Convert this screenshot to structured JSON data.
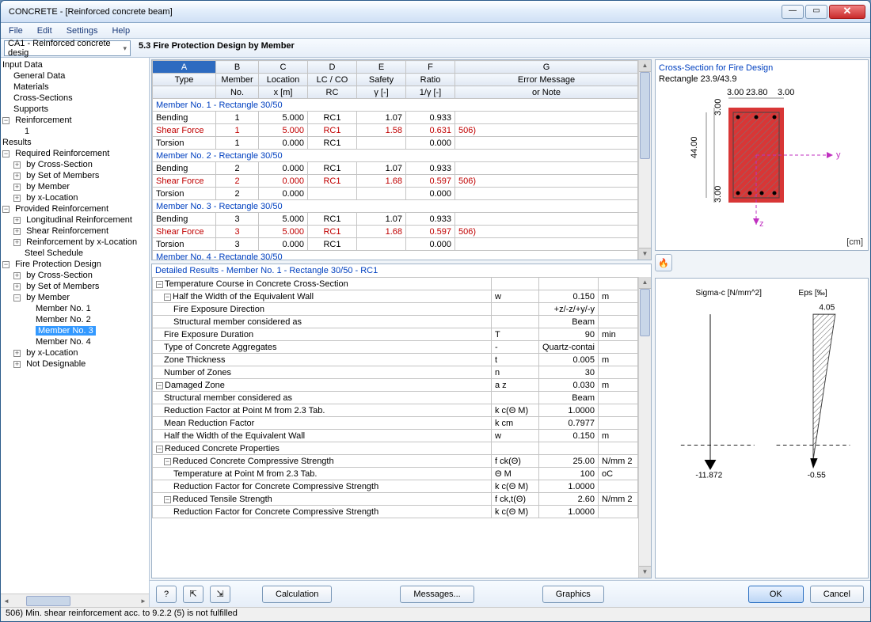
{
  "window": {
    "title": "CONCRETE - [Reinforced concrete beam]"
  },
  "menu": [
    "File",
    "Edit",
    "Settings",
    "Help"
  ],
  "combo": "CA1 - Reinforced concrete desig",
  "tree": {
    "input": "Input Data",
    "general": "General Data",
    "materials": "Materials",
    "cross": "Cross-Sections",
    "supports": "Supports",
    "reinf": "Reinforcement",
    "r1": "1",
    "results": "Results",
    "reqreinf": "Required Reinforcement",
    "bycs": "by Cross-Section",
    "bysom": "by Set of Members",
    "bymem": "by Member",
    "byx": "by x-Location",
    "prov": "Provided Reinforcement",
    "long": "Longitudinal Reinforcement",
    "shear": "Shear Reinforcement",
    "rbyx": "Reinforcement by x-Location",
    "steel": "Steel Schedule",
    "fire": "Fire Protection Design",
    "m1": "Member No. 1",
    "m2": "Member No. 2",
    "m3": "Member No. 3",
    "m4": "Member No. 4",
    "notdes": "Not Designable"
  },
  "panelTitle": "5.3 Fire Protection Design by Member",
  "cols": {
    "A": "A",
    "B": "B",
    "C": "C",
    "D": "D",
    "E": "E",
    "F": "F",
    "G": "G",
    "type": "Type",
    "memno": "Member",
    "memno2": "No.",
    "loc": "Location",
    "loc2": "x [m]",
    "lc": "LC / CO",
    "lc2": "RC",
    "saf": "Safety",
    "saf2": "γ [-]",
    "rat": "Ratio",
    "rat2": "1/γ [-]",
    "err": "Error Message",
    "err2": "or Note"
  },
  "groups": {
    "g1": "Member No. 1 - Rectangle 30/50",
    "g2": "Member No. 2 - Rectangle 30/50",
    "g3": "Member No. 3 - Rectangle 30/50",
    "g4": "Member No. 4 - Rectangle 30/50"
  },
  "rows": [
    [
      "Bending",
      "1",
      "5.000",
      "RC1",
      "1.07",
      "0.933",
      "",
      ""
    ],
    [
      "Shear Force",
      "1",
      "5.000",
      "RC1",
      "1.58",
      "0.631",
      "506)",
      "red"
    ],
    [
      "Torsion",
      "1",
      "0.000",
      "RC1",
      "",
      "0.000",
      "",
      ""
    ],
    [
      "Bending",
      "2",
      "0.000",
      "RC1",
      "1.07",
      "0.933",
      "",
      ""
    ],
    [
      "Shear Force",
      "2",
      "0.000",
      "RC1",
      "1.68",
      "0.597",
      "506)",
      "red"
    ],
    [
      "Torsion",
      "2",
      "0.000",
      "",
      "",
      "0.000",
      "",
      ""
    ],
    [
      "Bending",
      "3",
      "5.000",
      "RC1",
      "1.07",
      "0.933",
      "",
      ""
    ],
    [
      "Shear Force",
      "3",
      "5.000",
      "RC1",
      "1.68",
      "0.597",
      "506)",
      "red"
    ],
    [
      "Torsion",
      "3",
      "0.000",
      "RC1",
      "",
      "0.000",
      "",
      ""
    ]
  ],
  "detTitle": "Detailed Results  -  Member No. 1  -  Rectangle 30/50  -  RC1",
  "details": [
    [
      "g",
      "Temperature Course in Concrete Cross-Section",
      "",
      "",
      ""
    ],
    [
      "g1",
      "Half the Width of the Equivalent Wall",
      "w",
      "0.150",
      "m"
    ],
    [
      "2",
      "Fire Exposure Direction",
      "",
      "+z/-z/+y/-y",
      ""
    ],
    [
      "2",
      "Structural member considered as",
      "",
      "Beam",
      ""
    ],
    [
      "1",
      "Fire Exposure Duration",
      "T",
      "90",
      "min"
    ],
    [
      "1",
      "Type of Concrete Aggregates",
      "-",
      "Quartz-contai",
      ""
    ],
    [
      "1",
      "Zone Thickness",
      "t",
      "0.005",
      "m"
    ],
    [
      "1",
      "Number of Zones",
      "n",
      "30",
      ""
    ],
    [
      "g",
      "Damaged Zone",
      "a z",
      "0.030",
      "m"
    ],
    [
      "1",
      "Structural member considered as",
      "",
      "Beam",
      ""
    ],
    [
      "1",
      "Reduction Factor at Point M from 2.3 Tab.",
      "k c(Θ M)",
      "1.0000",
      ""
    ],
    [
      "1",
      "Mean Reduction Factor",
      "k cm",
      "0.7977",
      ""
    ],
    [
      "1",
      "Half the Width of the Equivalent Wall",
      "w",
      "0.150",
      "m"
    ],
    [
      "g",
      "Reduced Concrete Properties",
      "",
      "",
      ""
    ],
    [
      "g1",
      "Reduced Concrete Compressive Strength",
      "f ck(Θ)",
      "25.00",
      "N/mm 2"
    ],
    [
      "2",
      "Temperature at Point M from 2.3 Tab.",
      "Θ M",
      "100",
      "oC"
    ],
    [
      "2",
      "Reduction Factor for Concrete Compressive Strength",
      "k c(Θ M)",
      "1.0000",
      ""
    ],
    [
      "g1",
      "Reduced Tensile Strength",
      "f ck,t(Θ)",
      "2.60",
      "N/mm 2"
    ],
    [
      "2",
      "Reduction Factor for Concrete Compressive Strength",
      "k c(Θ M)",
      "1.0000",
      ""
    ]
  ],
  "cross": {
    "title": "Cross-Section for Fire Design",
    "sub": "Rectangle 23.9/43.9",
    "d1": "3.00",
    "d2": "23.80",
    "d3": "3.00",
    "h1": "3.00",
    "h2": "44.00",
    "h3": "3.00",
    "unit": "[cm]"
  },
  "sigma": {
    "l": "Sigma-c [N/mm^2]",
    "r": "Eps [‰]",
    "tv": "4.05",
    "bl": "-11.872",
    "br": "-0.55"
  },
  "buttons": {
    "calc": "Calculation",
    "msg": "Messages...",
    "gfx": "Graphics",
    "ok": "OK",
    "cancel": "Cancel"
  },
  "status": "506) Min. shear reinforcement acc. to 9.2.2 (5)  is not fulfilled"
}
